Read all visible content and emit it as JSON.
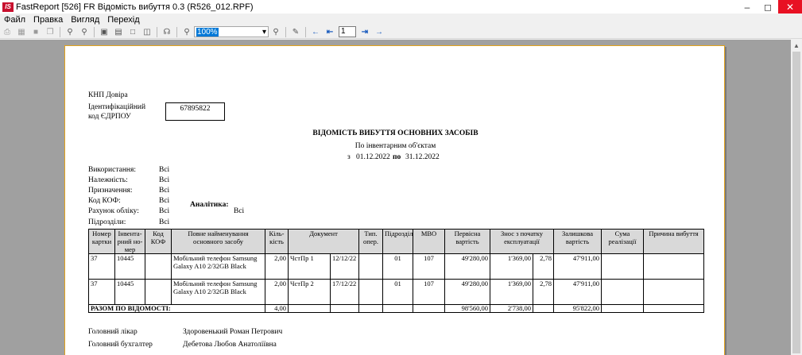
{
  "window": {
    "title": "FastReport [526] FR Відомість вибуття 0.3 (R526_012.RPF)",
    "logo": "IS"
  },
  "menu": [
    "Файл",
    "Правка",
    "Вигляд",
    "Перехід"
  ],
  "toolbar": {
    "zoom": "100%",
    "page": "1"
  },
  "report": {
    "org_name": "КНП Довіра",
    "edrpou_label_1": "Ідентифікаційний",
    "edrpou_label_2": "код ЄДРПОУ",
    "edrpou_value": "67895822",
    "title": "ВІДОМІСТЬ ВИБУТТЯ ОСНОВНИХ ЗАСОБІВ",
    "subtitle": "По інвентарним об'єктам",
    "period_from_label": "з",
    "period_from": "01.12.2022",
    "period_to_label": "по",
    "period_to": "31.12.2022",
    "filters": [
      {
        "label": "Використання:",
        "value": "Всі"
      },
      {
        "label": "Належність:",
        "value": "Всі"
      },
      {
        "label": "Призначення:",
        "value": "Всі"
      },
      {
        "label": "Код КОФ:",
        "value": "Всі"
      },
      {
        "label": "Рахунок обліку:",
        "value": "Всі"
      },
      {
        "label": "Підрозділи:",
        "value": "Всі"
      }
    ],
    "analytics_label": "Аналітика:",
    "analytics_value": "Всі",
    "columns": [
      "Номер картки",
      "Інвента-рний но-мер",
      "Код КОФ",
      "Повне найменування основного засобу",
      "Кіль-кість",
      "Документ",
      "Тип. опер.",
      "Підрозділ",
      "МВО",
      "Первісна вартість",
      "Знос з початку експлуатації",
      "Залишкова вартість",
      "Сума реалізації",
      "Причина вибуття"
    ],
    "rows": [
      {
        "card": "37",
        "inv": "10445",
        "kof": "",
        "name": "Мобільний телефон Samsung Galaxy A10 2/32GB Black",
        "qty": "2,00",
        "doc": "ЧстПр 1",
        "date": "12/12/22",
        "op": "",
        "dept": "01",
        "mvo": "107",
        "initial": "49'280,00",
        "wear": "1'369,00",
        "rate": "2,78",
        "residual": "47'911,00",
        "sale": "",
        "reason": ""
      },
      {
        "card": "37",
        "inv": "10445",
        "kof": "",
        "name": "Мобільний телефон Samsung Galaxy A10 2/32GB Black",
        "qty": "2,00",
        "doc": "ЧстПр 2",
        "date": "17/12/22",
        "op": "",
        "dept": "01",
        "mvo": "107",
        "initial": "49'280,00",
        "wear": "1'369,00",
        "rate": "2,78",
        "residual": "47'911,00",
        "sale": "",
        "reason": ""
      }
    ],
    "total": {
      "label": "РАЗОМ ПО ВІДОМОСТІ:",
      "qty": "4,00",
      "initial": "98'560,00",
      "wear": "2'738,00",
      "residual": "95'822,00"
    },
    "signatures": [
      {
        "role": "Головний лікар",
        "name": "Здоровенький Роман Петрович"
      },
      {
        "role": "Головний бухгалтер",
        "name": "Дебетова Любов Анатоліївна"
      }
    ]
  }
}
